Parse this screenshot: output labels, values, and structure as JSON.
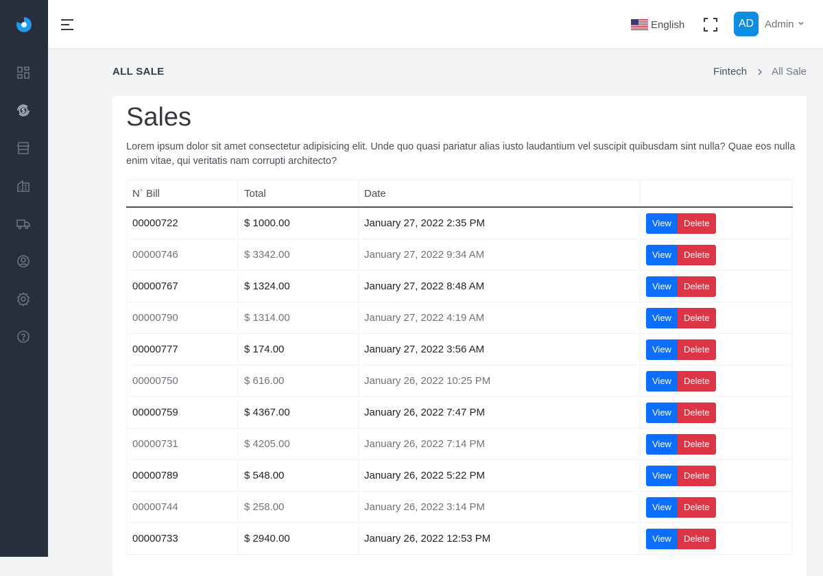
{
  "topbar": {
    "language": "English",
    "user": {
      "initials": "AD",
      "name": "Admin"
    }
  },
  "page": {
    "title": "ALL SALE",
    "breadcrumb": [
      "Fintech",
      "All Sale"
    ]
  },
  "card": {
    "title": "Sales",
    "description": "Lorem ipsum dolor sit amet consectetur adipisicing elit. Unde quo quasi pariatur alias iusto laudantium vel suscipit quibusdam sint nulla? Quae eos nulla enim vitae, qui veritatis nam corrupti architecto?"
  },
  "table": {
    "headers": [
      "N` Bill",
      "Total",
      "Date",
      ""
    ],
    "view_label": "View",
    "delete_label": "Delete",
    "rows": [
      {
        "bill": "00000722",
        "total": "$ 1000.00",
        "date": "January 27, 2022 2:35 PM"
      },
      {
        "bill": "00000746",
        "total": "$ 3342.00",
        "date": "January 27, 2022 9:34 AM"
      },
      {
        "bill": "00000767",
        "total": "$ 1324.00",
        "date": "January 27, 2022 8:48 AM"
      },
      {
        "bill": "00000790",
        "total": "$ 1314.00",
        "date": "January 27, 2022 4:19 AM"
      },
      {
        "bill": "00000777",
        "total": "$ 174.00",
        "date": "January 27, 2022 3:56 AM"
      },
      {
        "bill": "00000750",
        "total": "$ 616.00",
        "date": "January 26, 2022 10:25 PM"
      },
      {
        "bill": "00000759",
        "total": "$ 4367.00",
        "date": "January 26, 2022 7:47 PM"
      },
      {
        "bill": "00000731",
        "total": "$ 4205.00",
        "date": "January 26, 2022 7:14 PM"
      },
      {
        "bill": "00000789",
        "total": "$ 548.00",
        "date": "January 26, 2022 5:22 PM"
      },
      {
        "bill": "00000744",
        "total": "$ 258.00",
        "date": "January 26, 2022 3:14 PM"
      },
      {
        "bill": "00000733",
        "total": "$ 2940.00",
        "date": "January 26, 2022 12:53 PM"
      }
    ]
  }
}
